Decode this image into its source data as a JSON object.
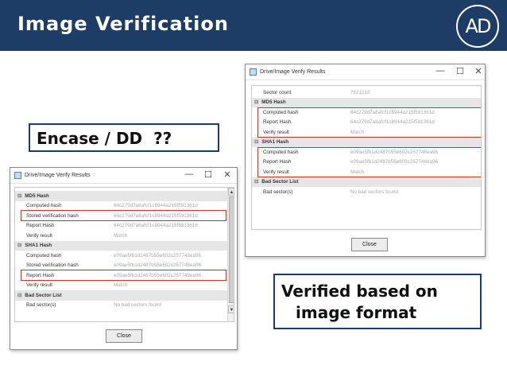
{
  "slide": {
    "title": "Image Verification",
    "logo_text": "AD",
    "callout_encase": "Encase / DD  ??",
    "callout_verified_line1": "Verified based on",
    "callout_verified_line2": "image format"
  },
  "window_controls": {
    "minimize": "—",
    "maximize": "☐",
    "close": "✕"
  },
  "left_window": {
    "title": "Drive/Image Verify Results",
    "close_label": "Close",
    "rows": [
      {
        "type": "section",
        "key": "MD5 Hash"
      },
      {
        "type": "item",
        "key": "Computed hash",
        "value": "64c279d7a8afcf1c8944a215f591361d"
      },
      {
        "type": "item",
        "key": "Stored verification hash",
        "value": "64c279d7a8afcf1c8944a215f591361d"
      },
      {
        "type": "item",
        "key": "Report Hash",
        "value": "64c279d7a8afcf1c8944a215f591361d"
      },
      {
        "type": "item",
        "key": "Verify result",
        "value": "Match"
      },
      {
        "type": "section",
        "key": "SHA1 Hash"
      },
      {
        "type": "item",
        "key": "Computed hash",
        "value": "e09ae5fb1d2487b55e602c257748ea96"
      },
      {
        "type": "item",
        "key": "Stored verification hash",
        "value": "e09ae5fb1d2487b55e602c257748ea96"
      },
      {
        "type": "item",
        "key": "Report Hash",
        "value": "e09ae5fb1d2487b55e602c257748ea96"
      },
      {
        "type": "item",
        "key": "Verify result",
        "value": "Match"
      },
      {
        "type": "section",
        "key": "Bad Sector List"
      },
      {
        "type": "item",
        "key": "Bad sector(s)",
        "value": "No bad sectors found"
      }
    ]
  },
  "right_window": {
    "title": "Drive/Image Verify Results",
    "close_label": "Close",
    "rows": [
      {
        "type": "item",
        "key": "Sector count",
        "value": "7821312"
      },
      {
        "type": "section",
        "key": "MD5 Hash"
      },
      {
        "type": "item",
        "key": "Computed hash",
        "value": "64c279d7a8afcf1c8944a215f591361d"
      },
      {
        "type": "item",
        "key": "Report Hash",
        "value": "64c279d7a8afcf1c8944a215f591361d"
      },
      {
        "type": "item",
        "key": "Verify result",
        "value": "Match"
      },
      {
        "type": "section",
        "key": "SHA1 Hash"
      },
      {
        "type": "item",
        "key": "Computed hash",
        "value": "e09ae5fb1d2487b55e602c257748ea96"
      },
      {
        "type": "item",
        "key": "Report Hash",
        "value": "e09ae5fb1d2487b55e602c257748ea96"
      },
      {
        "type": "item",
        "key": "Verify result",
        "value": "Match"
      },
      {
        "type": "section",
        "key": "Bad Sector List"
      },
      {
        "type": "item",
        "key": "Bad sector(s)",
        "value": "No bad sectors found"
      }
    ]
  }
}
